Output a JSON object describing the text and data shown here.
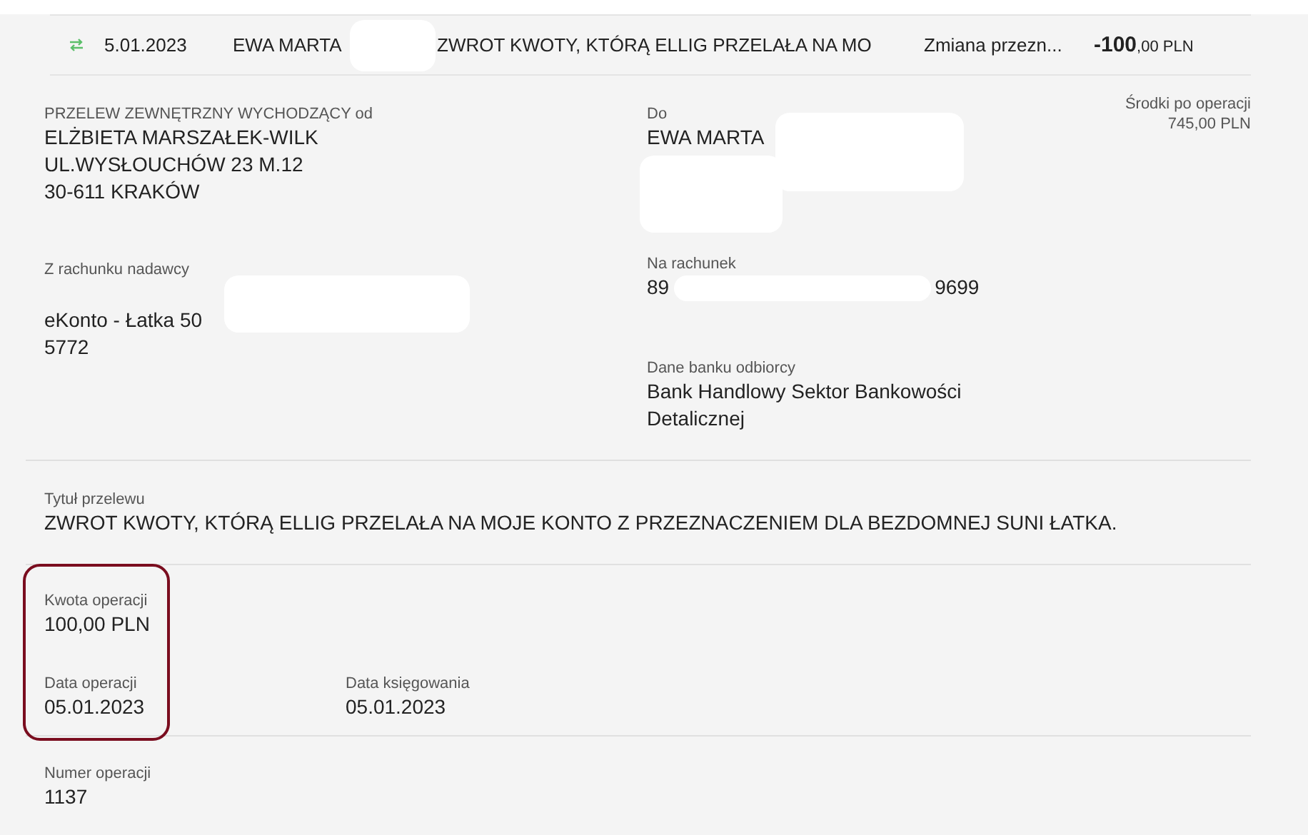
{
  "transaction_row": {
    "date": "5.01.2023",
    "name": "EWA MARTA",
    "title": "ZWROT KWOTY, KTÓRĄ ELLIG PRZELAŁA NA MO",
    "category": "Zmiana przezn...",
    "amount_main": "-100",
    "amount_rest": ",00 PLN"
  },
  "sender": {
    "label": "PRZELEW ZEWNĘTRZNY WYCHODZĄCY od",
    "lines": [
      "ELŻBIETA MARSZAŁEK-WILK",
      "UL.WYSŁOUCHÓW 23 M.12",
      "30-611 KRAKÓW"
    ]
  },
  "recipient": {
    "label": "Do",
    "lines": [
      "EWA MARTA"
    ]
  },
  "balance": {
    "label": "Środki po operacji",
    "value": "745,00 PLN"
  },
  "sender_account": {
    "label": "Z rachunku nadawcy",
    "lines": [
      "eKonto - Łatka 50",
      "5772"
    ]
  },
  "recipient_account": {
    "label": "Na rachunek",
    "start": "89",
    "end": "9699"
  },
  "bank": {
    "label": "Dane banku odbiorcy",
    "value": "Bank Handlowy Sektor Bankowości Detalicznej"
  },
  "transfer_title": {
    "label": "Tytuł przelewu",
    "value": "ZWROT KWOTY, KTÓRĄ ELLIG PRZELAŁA NA MOJE KONTO Z PRZEZNACZENIEM DLA BEZDOMNEJ SUNI ŁATKA."
  },
  "amount": {
    "label": "Kwota operacji",
    "value": "100,00 PLN"
  },
  "operation_date": {
    "label": "Data operacji",
    "value": "05.01.2023"
  },
  "booking_date": {
    "label": "Data księgowania",
    "value": "05.01.2023"
  },
  "operation_number": {
    "label": "Numer operacji",
    "value": "1137"
  }
}
